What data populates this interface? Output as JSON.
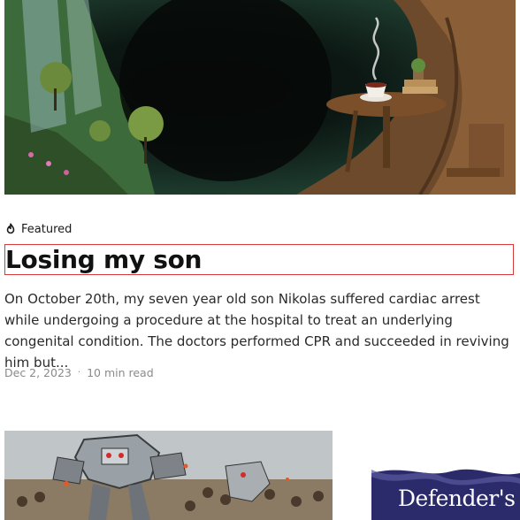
{
  "featured_post": {
    "badge_label": "Featured",
    "badge_icon": "flame-icon",
    "title": "Losing my son",
    "excerpt": "On October 20th, my seven year old son Nikolas suffered cardiac arrest while undergoing a procedure at the hospital to treat an underlying congenital condition. The doctors performed CPR and succeeded in reviving him but...",
    "date": "Dec 2, 2023",
    "separator": "·",
    "read_time": "10 min read"
  },
  "next_posts": {
    "right_thumbnail_text": "Defender's Qu"
  },
  "colors": {
    "title_outline": "#d63a3a",
    "meta_text": "#8a8a8a",
    "body_text": "#2a2a2a"
  }
}
